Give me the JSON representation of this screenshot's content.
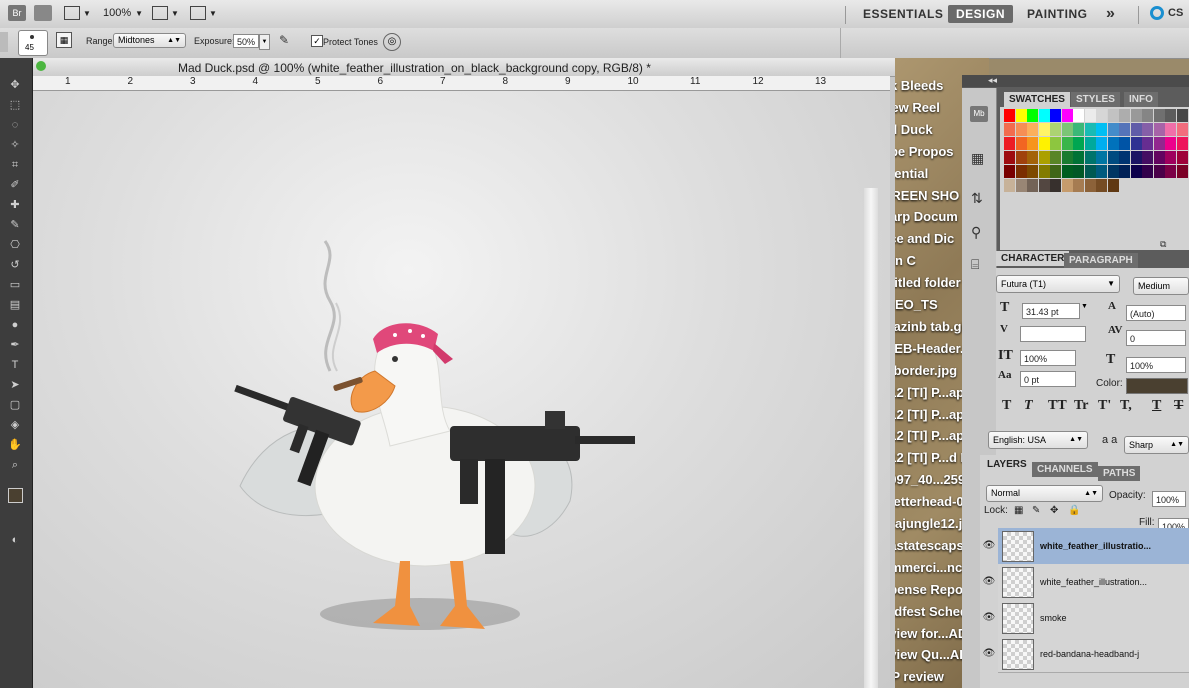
{
  "appbar": {
    "bridge_label": "Br",
    "zoom": "100%",
    "workspaces": [
      "ESSENTIALS",
      "DESIGN",
      "PAINTING"
    ],
    "active_workspace": "DESIGN",
    "more_label": "»",
    "cs_label": "CS"
  },
  "options": {
    "brush_size": "45",
    "range_label": "Range:",
    "range_value": "Midtones",
    "exposure_label": "Exposure:",
    "exposure_value": "50%",
    "protect_tones_label": "Protect Tones"
  },
  "document": {
    "title": "Mad Duck.psd @ 100% (white_feather_illustration_on_black_background copy, RGB/8) *",
    "ruler_ticks": [
      "1",
      "2",
      "3",
      "4",
      "5",
      "6",
      "7",
      "8",
      "9",
      "10",
      "11",
      "12",
      "13"
    ],
    "left_ruler_ticks": [
      "1",
      "2",
      "3",
      "4",
      "5",
      "6"
    ]
  },
  "desktop_files": [
    "nk Bleeds",
    "New Reel",
    "ad Duck",
    "obe Propos",
    "otential",
    "CREEN SHO",
    "harp Docum",
    "lice and Dic",
    "orn C",
    "ntitled folder",
    "IDEO_TS",
    "mazinb tab.gif",
    "WEB-Header.gif",
    "v-border.jpg",
    "012 [TI] P...ap r1.j",
    "012 [TI] P...ap r2.j",
    "012 [TI] P...ap r3.j",
    "012 [TI] P...d Map",
    "8097_40...259_n",
    "Fletterhead-01.j",
    "ltrajungle12.jpg",
    "sastatescaps.jpg",
    "ommerci...ncies.x",
    "xpense Report.xls",
    "radfest Schedule",
    "eview for...ADP",
    "eview Qu...ADP",
    "DP review",
    "dward Mi...posal"
  ],
  "swatches_panel": {
    "tabs": [
      "SWATCHES",
      "STYLES",
      "INFO"
    ],
    "active_tab": "SWATCHES",
    "colors": [
      "#ff0000",
      "#ffff00",
      "#00ff00",
      "#00ffff",
      "#0000ff",
      "#ff00ff",
      "#ffffff",
      "#ebebeb",
      "#d6d6d6",
      "#c2c2c2",
      "#adadad",
      "#999999",
      "#858585",
      "#707070",
      "#5c5c5c",
      "#474747",
      "#f26c4f",
      "#f68e55",
      "#fbaf5c",
      "#fff467",
      "#acd372",
      "#7cc576",
      "#3bb878",
      "#1abbb4",
      "#00bff3",
      "#438cca",
      "#5574b9",
      "#605ca8",
      "#855fa8",
      "#a763a8",
      "#f06ea9",
      "#f26d7d",
      "#ed1c24",
      "#f26522",
      "#f7941d",
      "#fff200",
      "#8dc63f",
      "#39b54a",
      "#00a651",
      "#00a99d",
      "#00aeef",
      "#0072bc",
      "#0054a6",
      "#2e3192",
      "#662d91",
      "#92278f",
      "#ec008c",
      "#ed145b",
      "#9e0b0f",
      "#a0410d",
      "#a36209",
      "#aba000",
      "#598527",
      "#1a7b30",
      "#007236",
      "#00746b",
      "#0076a3",
      "#004b80",
      "#003471",
      "#1b1464",
      "#440e62",
      "#630460",
      "#9e005d",
      "#9e0039",
      "#790000",
      "#7b2e00",
      "#7d4900",
      "#827b00",
      "#406618",
      "#005e20",
      "#005826",
      "#005952",
      "#005b7f",
      "#003663",
      "#002157",
      "#0d004c",
      "#32004b",
      "#4b0049",
      "#7b0046",
      "#7a0026",
      "#c7b299",
      "#998675",
      "#736357",
      "#534741",
      "#37302d",
      "#c69c6d",
      "#a67c52",
      "#8c6239",
      "#754c24",
      "#603913"
    ]
  },
  "character_panel": {
    "tabs": [
      "CHARACTER",
      "PARAGRAPH"
    ],
    "active_tab": "CHARACTER",
    "font_family": "Futura (T1)",
    "font_style": "Medium",
    "font_size": "31.43 pt",
    "leading": "(Auto)",
    "kerning": "",
    "tracking": "0",
    "vertical_scale": "100%",
    "horizontal_scale": "100%",
    "baseline_shift": "0 pt",
    "color_label": "Color:",
    "color_value": "#4a4030",
    "type_buttons": [
      "T",
      "T",
      "TT",
      "Tr",
      "T'",
      "T,",
      "T",
      "T"
    ],
    "language": "English: USA",
    "aa_label": "a a",
    "antialias": "Sharp"
  },
  "layers_panel": {
    "tabs": [
      "LAYERS",
      "CHANNELS",
      "PATHS"
    ],
    "active_tab": "LAYERS",
    "blend_mode": "Normal",
    "opacity_label": "Opacity:",
    "opacity_value": "100%",
    "lock_label": "Lock:",
    "fill_label": "Fill:",
    "fill_value": "100%",
    "layers": [
      {
        "name": "white_feather_illustratio...",
        "selected": true
      },
      {
        "name": "white_feather_illustration...",
        "selected": false
      },
      {
        "name": "smoke",
        "selected": false
      },
      {
        "name": "red-bandana-headband-j",
        "selected": false
      }
    ]
  }
}
